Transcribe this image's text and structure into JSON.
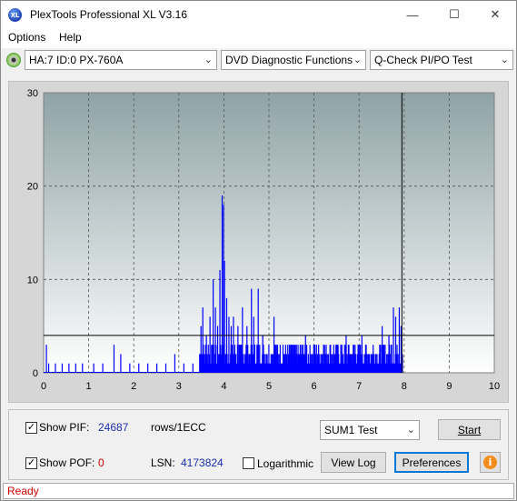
{
  "window": {
    "title": "PlexTools Professional XL V3.16",
    "logo_text": "XL"
  },
  "menu": {
    "options_label": "Options",
    "help_label": "Help"
  },
  "toolbar": {
    "drive_select": "HA:7 ID:0  PX-760A",
    "function_select": "DVD Diagnostic Functions",
    "test_select": "Q-Check PI/PO Test"
  },
  "chart_data": {
    "type": "bar",
    "x_ticks": [
      "0",
      "1",
      "2",
      "3",
      "4",
      "5",
      "6",
      "7",
      "8",
      "9",
      "10"
    ],
    "y_ticks": [
      "0",
      "10",
      "20",
      "30"
    ],
    "xlim": [
      0,
      10
    ],
    "ylim": [
      0,
      30
    ],
    "threshold": 4,
    "end_marker_x": 7.95,
    "grid": true,
    "colors": {
      "bars": "#0000ff",
      "bg_top": "#8fa3a6",
      "bg_bottom": "#ffffff",
      "line": "#000000"
    },
    "sparse_spikes": [
      {
        "x": 0.05,
        "y": 3
      },
      {
        "x": 0.1,
        "y": 1
      },
      {
        "x": 0.25,
        "y": 1
      },
      {
        "x": 0.4,
        "y": 1
      },
      {
        "x": 0.55,
        "y": 1
      },
      {
        "x": 0.7,
        "y": 1
      },
      {
        "x": 0.85,
        "y": 1
      },
      {
        "x": 1.1,
        "y": 1
      },
      {
        "x": 1.3,
        "y": 1
      },
      {
        "x": 1.55,
        "y": 3
      },
      {
        "x": 1.7,
        "y": 2
      },
      {
        "x": 1.9,
        "y": 1
      },
      {
        "x": 2.1,
        "y": 1
      },
      {
        "x": 2.3,
        "y": 1
      },
      {
        "x": 2.5,
        "y": 1
      },
      {
        "x": 2.7,
        "y": 1
      },
      {
        "x": 2.9,
        "y": 2
      },
      {
        "x": 3.1,
        "y": 1
      },
      {
        "x": 3.3,
        "y": 1
      }
    ],
    "spikes": [
      {
        "x": 3.48,
        "y": 5
      },
      {
        "x": 3.52,
        "y": 7
      },
      {
        "x": 3.6,
        "y": 4
      },
      {
        "x": 3.68,
        "y": 6
      },
      {
        "x": 3.75,
        "y": 10
      },
      {
        "x": 3.8,
        "y": 7
      },
      {
        "x": 3.85,
        "y": 5
      },
      {
        "x": 3.9,
        "y": 11
      },
      {
        "x": 3.95,
        "y": 19
      },
      {
        "x": 3.98,
        "y": 18
      },
      {
        "x": 4.0,
        "y": 12
      },
      {
        "x": 4.05,
        "y": 8
      },
      {
        "x": 4.1,
        "y": 6
      },
      {
        "x": 4.15,
        "y": 5
      },
      {
        "x": 4.2,
        "y": 6
      },
      {
        "x": 4.3,
        "y": 5
      },
      {
        "x": 4.4,
        "y": 7
      },
      {
        "x": 4.5,
        "y": 5
      },
      {
        "x": 4.6,
        "y": 9
      },
      {
        "x": 4.65,
        "y": 6
      },
      {
        "x": 4.75,
        "y": 9
      },
      {
        "x": 4.85,
        "y": 4
      },
      {
        "x": 5.1,
        "y": 6
      },
      {
        "x": 5.3,
        "y": 3
      },
      {
        "x": 5.5,
        "y": 3
      },
      {
        "x": 5.8,
        "y": 4
      },
      {
        "x": 6.0,
        "y": 3
      },
      {
        "x": 6.2,
        "y": 3
      },
      {
        "x": 6.5,
        "y": 3
      },
      {
        "x": 6.7,
        "y": 4
      },
      {
        "x": 6.9,
        "y": 3
      },
      {
        "x": 7.05,
        "y": 4
      },
      {
        "x": 7.3,
        "y": 3
      },
      {
        "x": 7.5,
        "y": 5
      },
      {
        "x": 7.65,
        "y": 4
      },
      {
        "x": 7.75,
        "y": 7
      },
      {
        "x": 7.8,
        "y": 6
      },
      {
        "x": 7.88,
        "y": 7
      },
      {
        "x": 7.92,
        "y": 5
      }
    ]
  },
  "controls": {
    "show_pif_label": "Show PIF:",
    "pif_value": "24687",
    "pif_unit": "rows/1ECC",
    "show_pof_label": "Show POF:",
    "pof_value": "0",
    "lsn_label": "LSN:",
    "lsn_value": "4173824",
    "logarithmic_label": "Logarithmic",
    "sum_select": "SUM1 Test",
    "start_label": "Start",
    "viewlog_label": "View Log",
    "preferences_label": "Preferences",
    "check_mark": "✓"
  },
  "status": {
    "text": "Ready"
  }
}
